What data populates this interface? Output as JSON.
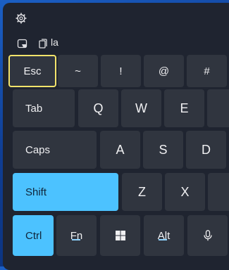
{
  "toolbar": {
    "language_label": "la"
  },
  "keys": {
    "row1": [
      "Esc",
      "~",
      "!",
      "@",
      "#"
    ],
    "row2": [
      "Tab",
      "Q",
      "W",
      "E"
    ],
    "row3": [
      "Caps",
      "A",
      "S",
      "D"
    ],
    "row4": [
      "Shift",
      "Z",
      "X"
    ],
    "row5": {
      "ctrl": "Ctrl",
      "fn": "Fn",
      "alt": "Alt"
    }
  },
  "colors": {
    "accent": "#4cc2ff",
    "focus_ring": "#f3e46b",
    "key_bg": "#30353f",
    "panel_bg": "#1f2430"
  },
  "icons": {
    "settings": "gear-icon",
    "layout": "keyboard-layout-icon",
    "clipboard": "clipboard-icon",
    "windows": "windows-logo-icon",
    "microphone": "microphone-icon"
  }
}
